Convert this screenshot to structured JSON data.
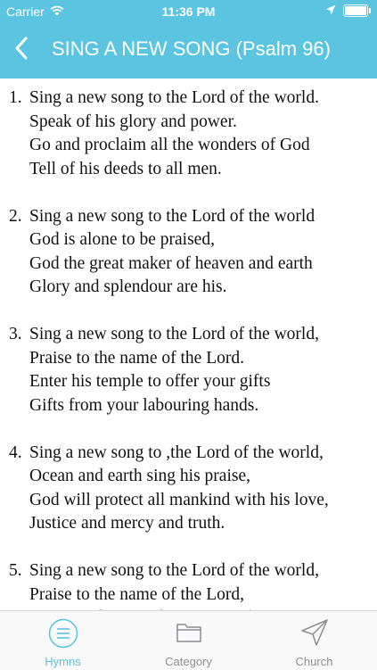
{
  "status_bar": {
    "carrier": "Carrier",
    "time": "11:36 PM"
  },
  "nav": {
    "title": "SING A NEW SONG (Psalm 96)",
    "back_icon": "chevron-left-icon"
  },
  "stanzas": [
    {
      "number": "1.",
      "lines": [
        "Sing a new song to the Lord of the world.",
        "Speak of his glory and power.",
        "Go and proclaim all the wonders of God",
        "Tell of his deeds to all men."
      ]
    },
    {
      "number": "2.",
      "lines": [
        "Sing a new song to the Lord of the world",
        "God is alone to be praised,",
        "God the great maker of heaven and earth",
        "Glory and splendour are his."
      ]
    },
    {
      "number": "3.",
      "lines": [
        "Sing a new song to the Lord of the world,",
        "Praise to the name of the Lord.",
        "Enter his temple to offer your gifts",
        "Gifts from your labouring hands."
      ]
    },
    {
      "number": "4.",
      "lines": [
        "Sing a new song to ,the Lord of the world,",
        "Ocean and earth sing his praise,",
        "God will protect all mankind with his love,",
        "Justice and mercy and truth."
      ]
    },
    {
      "number": "5.",
      "lines": [
        "Sing a new song to the Lord of the world,",
        "Praise to the name of the Lord,",
        "Father and Son and the Spirit of Light"
      ]
    }
  ],
  "tabs": [
    {
      "label": "Hymns",
      "icon": "list-icon",
      "active": true
    },
    {
      "label": "Category",
      "icon": "folder-icon",
      "active": false
    },
    {
      "label": "Church",
      "icon": "send-icon",
      "active": false
    }
  ],
  "colors": {
    "accent": "#5bc4e0",
    "inactive": "#8e8e93"
  }
}
